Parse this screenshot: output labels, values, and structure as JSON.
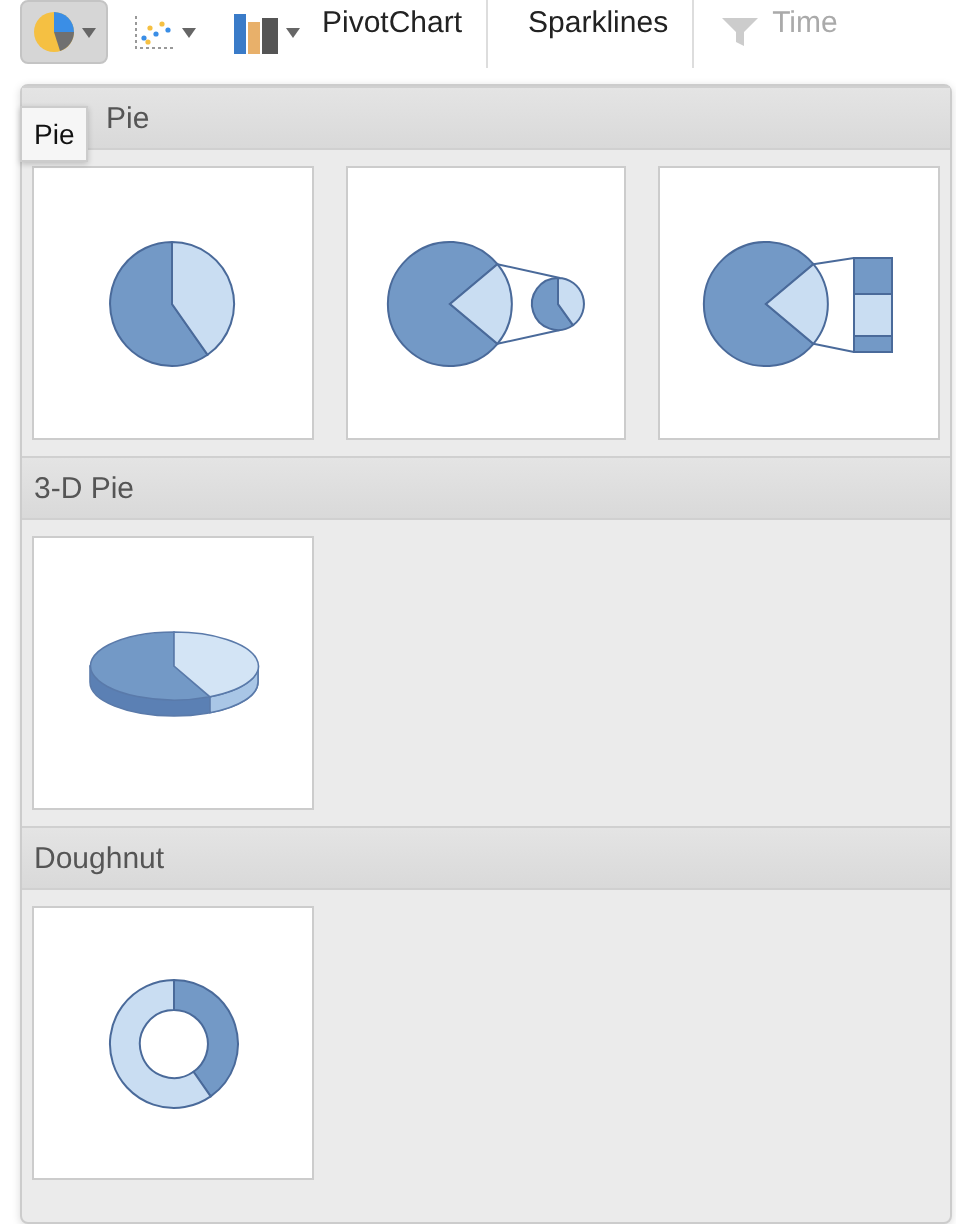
{
  "toolbar": [
    {
      "kind": "pie",
      "selected": true
    },
    {
      "kind": "scatter",
      "selected": false
    },
    {
      "kind": "bar",
      "label": "PivotChart",
      "selected": false
    },
    {
      "kind": "text",
      "label": "Sparklines",
      "selected": false
    },
    {
      "kind": "filter",
      "label": "Time",
      "selected": false
    }
  ],
  "tooltip": "Pie",
  "sections": [
    {
      "title": "Pie",
      "options": [
        {
          "kind": "pie"
        },
        {
          "kind": "pie-of-pie"
        },
        {
          "kind": "bar-of-pie"
        }
      ]
    },
    {
      "title": "3-D Pie",
      "options": [
        {
          "kind": "pie-3d"
        }
      ]
    },
    {
      "title": "Doughnut",
      "options": [
        {
          "kind": "doughnut"
        }
      ]
    }
  ]
}
